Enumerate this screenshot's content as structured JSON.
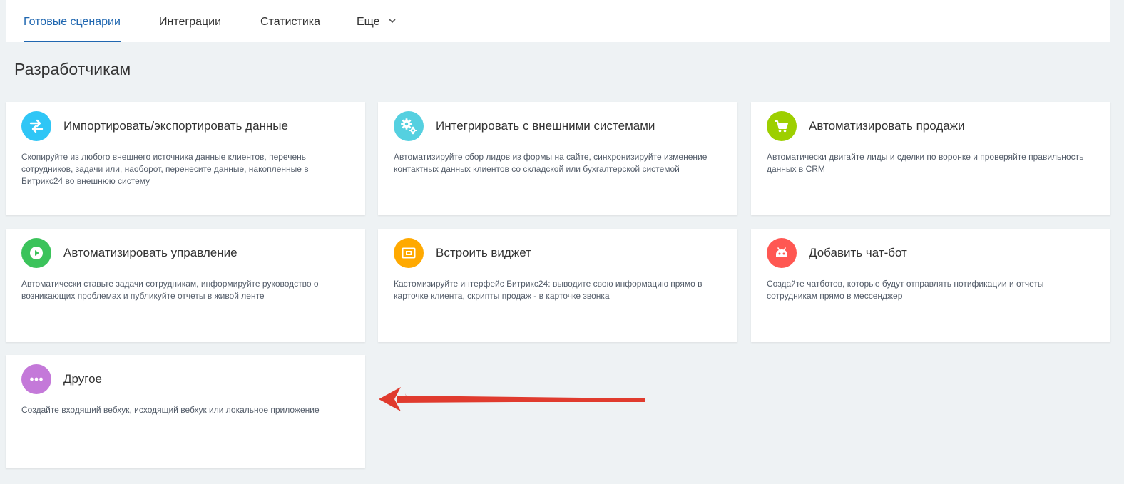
{
  "nav": {
    "tabs": [
      {
        "label": "Готовые сценарии",
        "active": true
      },
      {
        "label": "Интеграции",
        "active": false
      },
      {
        "label": "Статистика",
        "active": false
      },
      {
        "label": "Еще",
        "active": false
      }
    ]
  },
  "section": {
    "title": "Разработчикам"
  },
  "cards": [
    {
      "title": "Импортировать/экспортировать данные",
      "description": "Скопируйте из любого внешнего источника данные клиентов, перечень сотрудников, задачи или, наоборот, перенесите данные, накопленные в Битрикс24 во внешнюю систему",
      "icon": "exchange-arrows-icon",
      "color": "#2fc6f6"
    },
    {
      "title": "Интегрировать с внешними системами",
      "description": "Автоматизируйте сбор лидов из формы на сайте, синхронизируйте изменение контактных данных клиентов со складской или бухгалтерской системой",
      "icon": "gears-icon",
      "color": "#55d0e0"
    },
    {
      "title": "Автоматизировать продажи",
      "description": "Автоматически двигайте лиды и сделки по воронке и проверяйте правильность данных в CRM",
      "icon": "shopping-cart-icon",
      "color": "#9dcf00"
    },
    {
      "title": "Автоматизировать управление",
      "description": "Автоматически ставьте задачи сотрудникам, информируйте руководство о возникающих проблемах и публикуйте отчеты в живой ленте",
      "icon": "play-icon",
      "color": "#3bc35b"
    },
    {
      "title": "Встроить виджет",
      "description": "Кастомизируйте интерфейс Битрикс24: выводите свою информацию прямо в карточке клиента, скрипты продаж - в карточке звонка",
      "icon": "widget-icon",
      "color": "#ffa900"
    },
    {
      "title": "Добавить чат-бот",
      "description": "Создайте чатботов, которые будут отправлять нотификации и отчеты сотрудникам прямо в мессенджер",
      "icon": "robot-icon",
      "color": "#ff5752"
    },
    {
      "title": "Другое",
      "description": "Создайте входящий вебхук, исходящий вебхук или локальное приложение",
      "icon": "more-dots-icon",
      "color": "#c479d9"
    }
  ],
  "annotation": {
    "arrow_color": "#e03b2e"
  }
}
